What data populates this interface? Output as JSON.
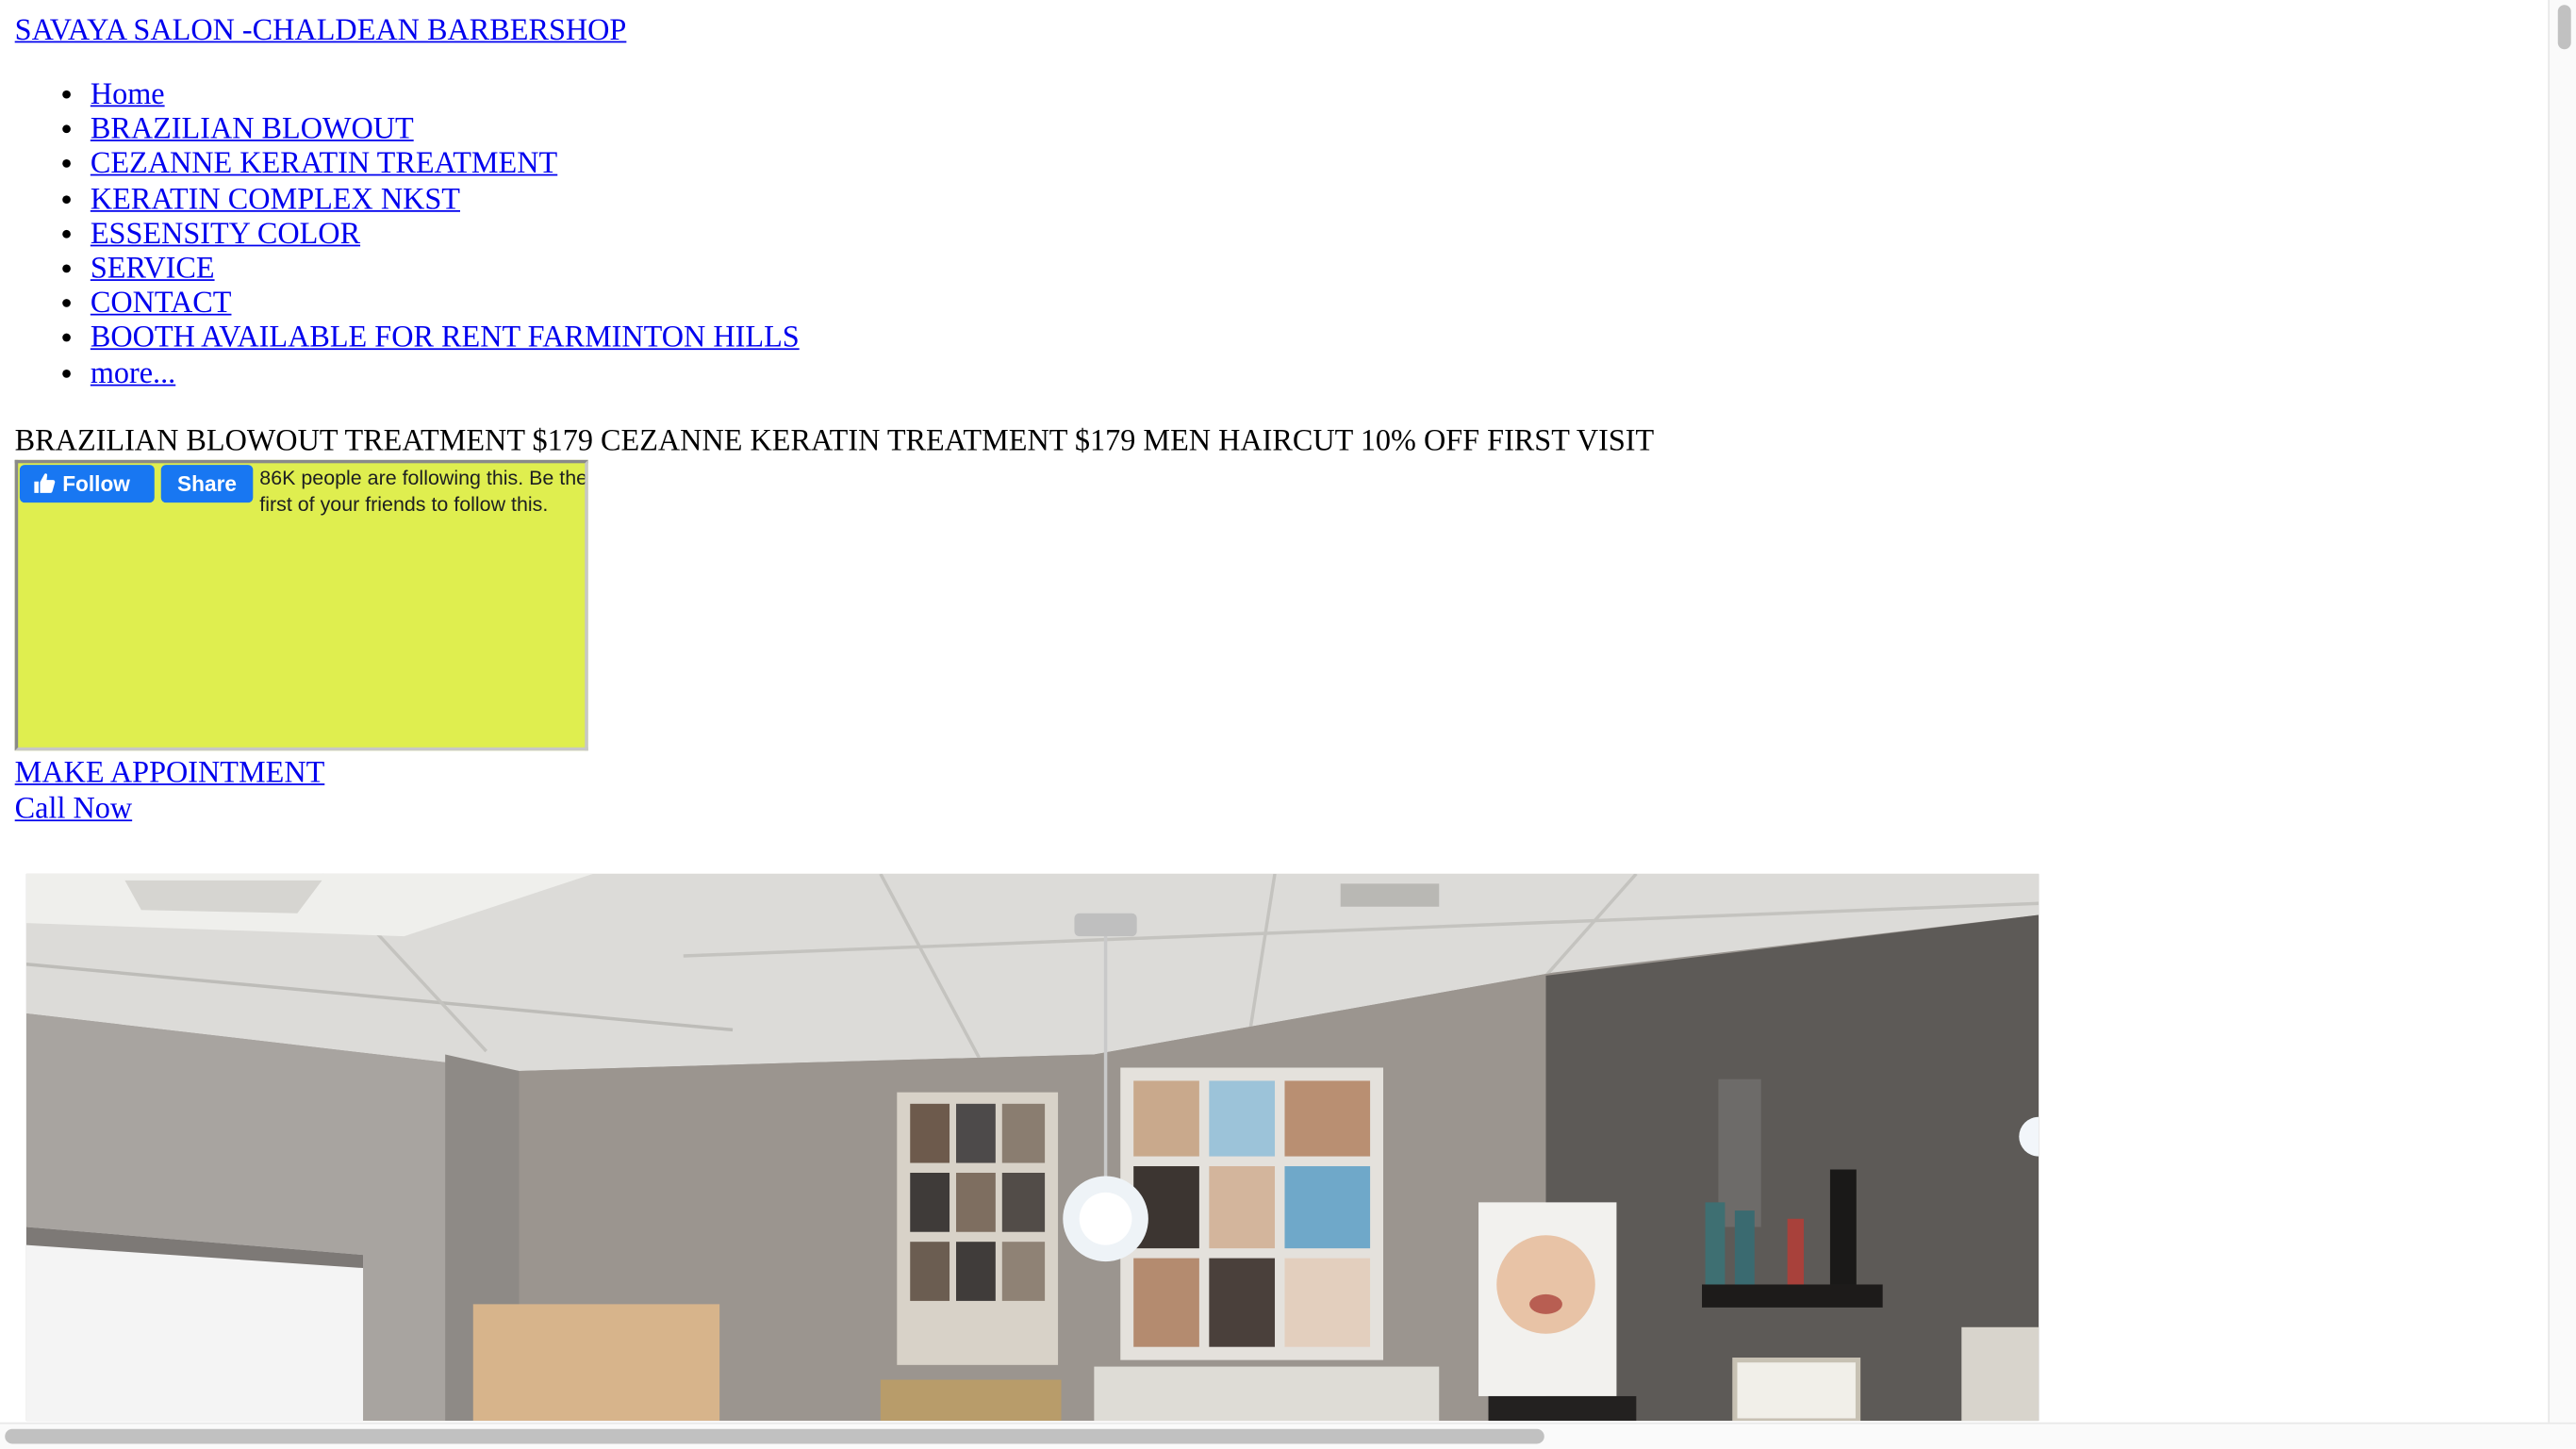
{
  "site": {
    "title": "SAVAYA SALON -CHALDEAN BARBERSHOP"
  },
  "nav": {
    "items": [
      {
        "label": "Home"
      },
      {
        "label": "BRAZILIAN BLOWOUT"
      },
      {
        "label": "CEZANNE KERATIN TREATMENT"
      },
      {
        "label": "KERATIN COMPLEX NKST"
      },
      {
        "label": "ESSENSITY COLOR"
      },
      {
        "label": "SERVICE"
      },
      {
        "label": "CONTACT"
      },
      {
        "label": "BOOTH AVAILABLE FOR RENT FARMINTON HILLS"
      },
      {
        "label": "more..."
      }
    ]
  },
  "promo": {
    "text": "BRAZILIAN BLOWOUT TREATMENT $179 CEZANNE KERATIN TREATMENT $179 MEN HAIRCUT 10% OFF FIRST VISIT"
  },
  "facebook": {
    "follow_label": "Follow",
    "share_label": "Share",
    "count_text": "86K people are following this. Be the first of your friends to follow this.",
    "background_color": "#dfee4f",
    "button_color": "#1877f2"
  },
  "links": {
    "appointment_label": "MAKE APPOINTMENT",
    "call_label": "Call Now"
  },
  "icons": {
    "follow": "thumbs-up-icon"
  }
}
